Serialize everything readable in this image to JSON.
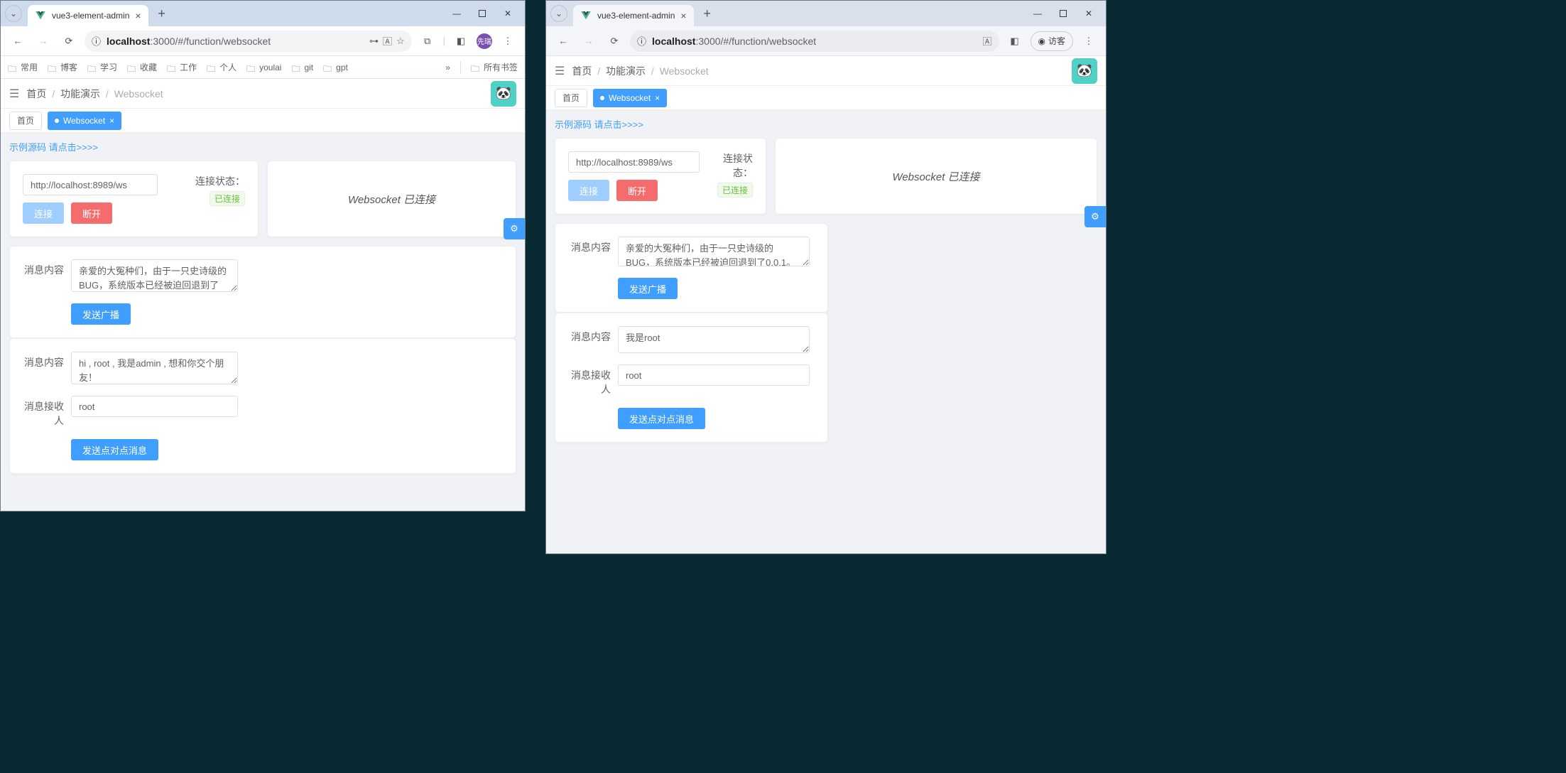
{
  "left": {
    "browser_tab": "vue3-element-admin",
    "url_host": "localhost",
    "url_port_path": ":3000/#/function/websocket",
    "avatar_badge": "先瑞",
    "bookmarks": [
      "常用",
      "博客",
      "学习",
      "收藏",
      "工作",
      "个人",
      "youlai",
      "git",
      "gpt"
    ],
    "bookmarks_overflow": "»",
    "bookmarks_all": "所有书签",
    "breadcrumb": {
      "home": "首页",
      "demo": "功能演示",
      "page": "Websocket"
    },
    "tabs": {
      "home": "首页",
      "active": "Websocket"
    },
    "source_link": "示例源码 请点击>>>>",
    "ws_url": "http://localhost:8989/ws",
    "btn_connect": "连接",
    "btn_disconnect": "断开",
    "status_label": "连接状态：",
    "status_value": "已连接",
    "status_banner": "Websocket 已连接",
    "broadcast": {
      "label": "消息内容",
      "value": "亲爱的大冤种们，由于一只史诗级的BUG，系统版本已经被迫回退到了",
      "send": "发送广播"
    },
    "p2p": {
      "content_label": "消息内容",
      "content_value": "hi , root , 我是admin , 想和你交个朋友！",
      "recipient_label": "消息接收人",
      "recipient_value": "root",
      "send": "发送点对点消息"
    }
  },
  "right": {
    "browser_tab": "vue3-element-admin",
    "url_host": "localhost",
    "url_port_path": ":3000/#/function/websocket",
    "guest_label": "访客",
    "breadcrumb": {
      "home": "首页",
      "demo": "功能演示",
      "page": "Websocket"
    },
    "tabs": {
      "home": "首页",
      "active": "Websocket"
    },
    "source_link": "示例源码 请点击>>>>",
    "ws_url": "http://localhost:8989/ws",
    "btn_connect": "连接",
    "btn_disconnect": "断开",
    "status_label": "连接状态：",
    "status_value": "已连接",
    "status_banner": "Websocket 已连接",
    "broadcast": {
      "label": "消息内容",
      "value": "亲爱的大冤种们，由于一只史诗级的BUG，系统版本已经被迫回退到了0.0.1。",
      "send": "发送广播"
    },
    "p2p": {
      "content_label": "消息内容",
      "content_value": "我是root",
      "recipient_label": "消息接收人",
      "recipient_value": "root",
      "send": "发送点对点消息"
    }
  }
}
